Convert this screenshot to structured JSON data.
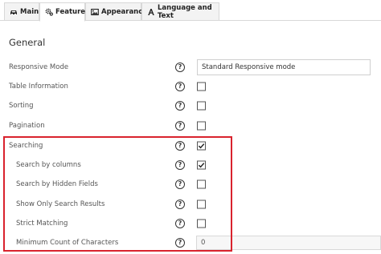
{
  "tabs": [
    {
      "label": "Main",
      "icon": "car-icon"
    },
    {
      "label": "Features",
      "icon": "cogs-icon"
    },
    {
      "label": "Appearance",
      "icon": "image-icon"
    },
    {
      "label": "Language and Text",
      "icon": "font-icon"
    }
  ],
  "active_tab": "Features",
  "section_title": "General",
  "help_glyph": "?",
  "settings": {
    "responsive_mode": {
      "label": "Responsive Mode",
      "value": "Standard Responsive mode"
    },
    "table_information": {
      "label": "Table Information",
      "checked": false
    },
    "sorting": {
      "label": "Sorting",
      "checked": false
    },
    "pagination": {
      "label": "Pagination",
      "checked": false
    },
    "searching": {
      "label": "Searching",
      "checked": true
    },
    "search_by_columns": {
      "label": "Search by columns",
      "checked": true
    },
    "search_by_hidden_fields": {
      "label": "Search by Hidden Fields",
      "checked": false
    },
    "show_only_search_results": {
      "label": "Show Only Search Results",
      "checked": false
    },
    "strict_matching": {
      "label": "Strict Matching",
      "checked": false
    },
    "minimum_count_of_characters": {
      "label": "Minimum Count of Characters",
      "value": "0"
    }
  },
  "colors": {
    "highlight": "#d9232e",
    "tab_inactive": "#f3f3f3",
    "border": "#d8d8d8"
  }
}
